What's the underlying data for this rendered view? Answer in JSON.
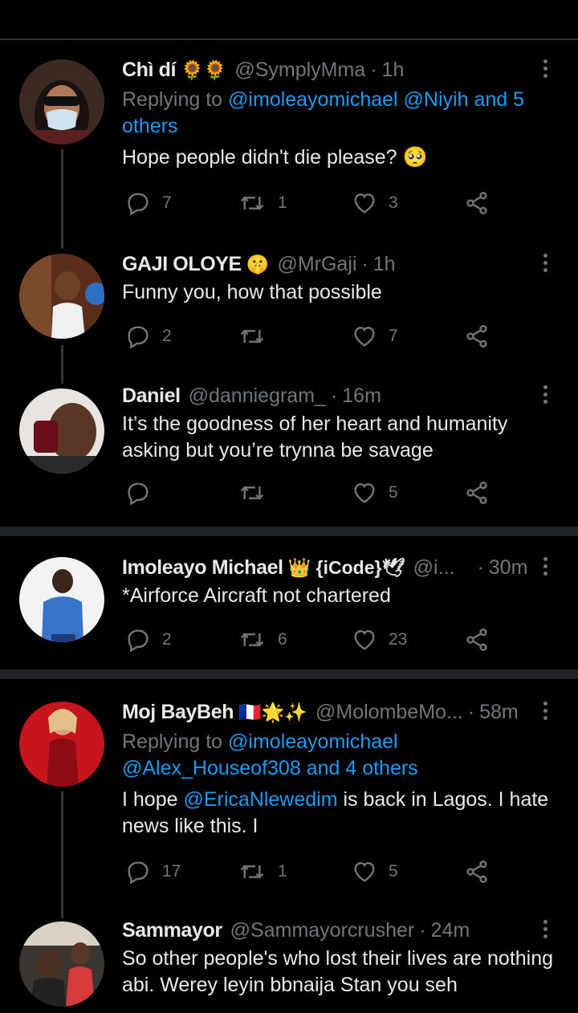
{
  "tweets": [
    {
      "name": "Chì dí",
      "name_emoji": "🌻🌻",
      "handle": "@SymplyMma",
      "time": "1h",
      "reply_prefix": "Replying to",
      "reply_line1_mentions": "@imoleayomichael @Niyih and 5",
      "reply_line2": "others",
      "body": "Hope people didn't die please? 🥺",
      "replies": "7",
      "retweets": "1",
      "likes": "3"
    },
    {
      "name": "GAJI OLOYE",
      "name_emoji": "🤫",
      "handle": "@MrGaji",
      "time": "1h",
      "body": "Funny you, how that possible",
      "replies": "2",
      "retweets": "",
      "likes": "7"
    },
    {
      "name": "Daniel",
      "handle": "@danniegram_",
      "time": "16m",
      "body_line1": "It’s the goodness of her heart and humanity",
      "body_line2": "asking but you’re trynna be savage",
      "replies": "",
      "retweets": "",
      "likes": "5"
    },
    {
      "name": "Imoleayo Michael",
      "name_emoji": "👑 {iCode}🕊",
      "handle": "@i...",
      "time": "30m",
      "body": "*Airforce Aircraft not chartered",
      "replies": "2",
      "retweets": "6",
      "likes": "23"
    },
    {
      "name": "Moj BayBeh",
      "name_emoji": "🇫🇷🌟✨",
      "handle": "@MolombeMo...",
      "time": "58m",
      "reply_prefix": "Replying to",
      "reply_line1_mentions": "@imoleayomichael",
      "reply_line2_mentions": "@Alex_Houseof308 and 4 others",
      "body_pre": "I hope ",
      "body_mention": "@EricaNlewedim",
      "body_post": " is back in Lagos. I hate",
      "body_line2": "news like this. I",
      "replies": "17",
      "retweets": "1",
      "likes": "5"
    },
    {
      "name": "Sammayor",
      "handle": "@Sammayorcrusher",
      "time": "24m",
      "body_line1": "So other people's who lost their lives are nothing",
      "body_line2": "abi. Werey leyin bbnaija Stan you seh"
    }
  ],
  "icons": [
    "reply-icon",
    "retweet-icon",
    "like-icon",
    "share-icon",
    "more-icon"
  ],
  "colors": {
    "background": "#000000",
    "text": "#e7e9ea",
    "muted": "#71767b",
    "link": "#1d9bf0",
    "separator": "#2f3336"
  }
}
